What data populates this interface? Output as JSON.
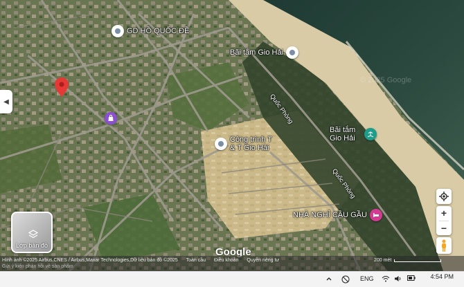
{
  "map": {
    "places": [
      {
        "name": "GD HỒ QUỐC ĐỀ",
        "type": "place"
      },
      {
        "name": "Bãi tắm Gio Hải",
        "type": "place"
      },
      {
        "name": "Công trình T & T Gio Hải",
        "type": "place"
      },
      {
        "name": "Bãi tắm Gio Hải",
        "type": "beach"
      },
      {
        "name": "NHÀ NGHỈ CẦU GẦU",
        "type": "hotel"
      }
    ],
    "roads": [
      "Quốc Phòng",
      "Quốc Phòng"
    ],
    "watermark": "© 2025 Google",
    "logo": "Google"
  },
  "controls": {
    "layer_label": "Lớp bản đồ",
    "collapse_icon": "chevron-left-icon",
    "zoom_in": "+",
    "zoom_out": "−"
  },
  "footer": {
    "credits": "Hình ảnh ©2025 Airbus,CNES / Airbus,Maxar Technologies,Dữ liệu bản đồ ©2025",
    "links": [
      "Toàn cầu",
      "Điều khoản",
      "Quyền riêng tư"
    ],
    "feedback": "Gửi ý kiến phản hồi về sản phẩm",
    "scale": "200 mét"
  },
  "taskbar": {
    "lang": "ENG",
    "time": "4:54 PM"
  },
  "colors": {
    "sea": "#2f4a3e",
    "sand": "#cdbf99",
    "land": "#5a6b43",
    "beach_pin": "#1f9d8b",
    "hotel_pin": "#d43c92",
    "red_pin": "#e53935"
  }
}
